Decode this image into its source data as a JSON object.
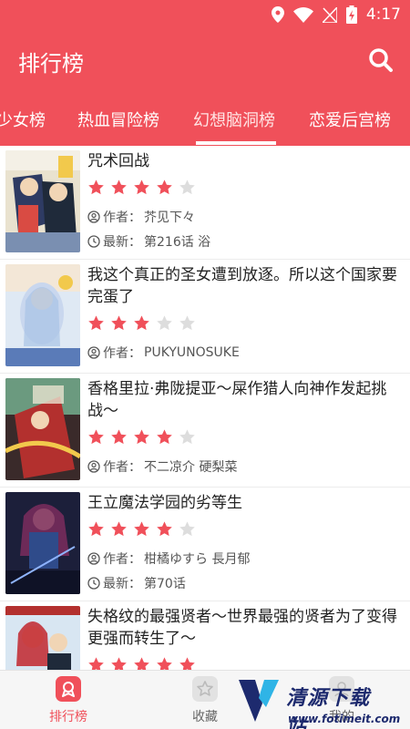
{
  "status_bar": {
    "time": "4:17"
  },
  "header": {
    "title": "排行榜",
    "search_icon": "search-icon"
  },
  "tabs": [
    {
      "label": "少女榜"
    },
    {
      "label": "热血冒险榜"
    },
    {
      "label": "幻想脑洞榜",
      "active": true
    },
    {
      "label": "恋爱后宫榜"
    }
  ],
  "manga_list": [
    {
      "title": "咒术回战",
      "rating": 4,
      "author_label": "作者：",
      "author": "芥见下々",
      "latest_label": "最新：",
      "latest": "第216话 浴"
    },
    {
      "title": "我这个真正的圣女遭到放逐。所以这个国家要完蛋了",
      "rating": 3,
      "author_label": "作者：",
      "author": "PUKYUNOSUKE"
    },
    {
      "title": "香格里拉·弗陇提亚～屎作猎人向神作发起挑战～",
      "rating": 4,
      "author_label": "作者：",
      "author": "不二凉介 硬梨菜"
    },
    {
      "title": "王立魔法学园的劣等生",
      "rating": 4,
      "author_label": "作者：",
      "author": "柑橘ゆすら 長月郁",
      "latest_label": "最新：",
      "latest": "第70话"
    },
    {
      "title": "失格纹的最强贤者～世界最强的贤者为了变得更强而转生了～",
      "rating": 5
    }
  ],
  "bottom_nav": [
    {
      "label": "排行榜",
      "icon": "ranking-icon",
      "active": true
    },
    {
      "label": "收藏",
      "icon": "star-icon"
    },
    {
      "label": "我的",
      "icon": "profile-icon"
    }
  ],
  "watermark": {
    "text": "清源下载站",
    "url": "www.fotimeit.com"
  },
  "colors": {
    "primary": "#f0505a",
    "star_on": "#f0505a",
    "star_off": "#dddddd"
  }
}
